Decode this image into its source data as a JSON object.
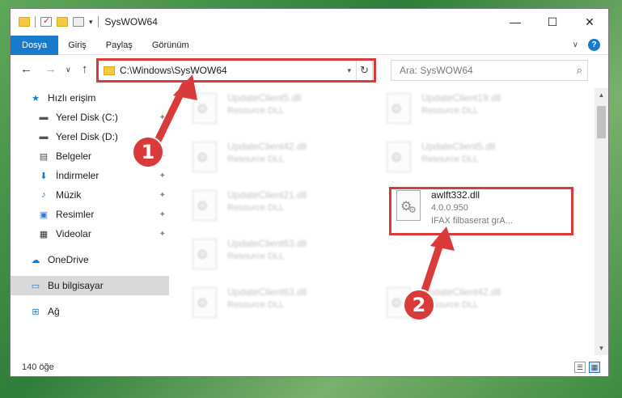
{
  "window": {
    "title": "SysWOW64",
    "controls": {
      "minimize": "—",
      "maximize": "☐",
      "close": "✕"
    }
  },
  "ribbon": {
    "tabs": [
      "Dosya",
      "Giriş",
      "Paylaş",
      "Görünüm"
    ],
    "expand": "∨",
    "help": "?"
  },
  "nav": {
    "back": "←",
    "forward": "→",
    "recent": "∨",
    "up": "↑",
    "address": "C:\\Windows\\SysWOW64",
    "refresh": "↻",
    "search_placeholder": "Ara: SysWOW64",
    "search_icon": "⌕"
  },
  "sidebar": {
    "items": [
      {
        "label": "Hızlı erişim",
        "icon": "star-icon",
        "glyph": "★",
        "color": "#1979ca",
        "pinned": false
      },
      {
        "label": "Yerel Disk (C:)",
        "icon": "drive-icon",
        "glyph": "▬",
        "color": "#555555",
        "pinned": true
      },
      {
        "label": "Yerel Disk (D:)",
        "icon": "drive-icon",
        "glyph": "▬",
        "color": "#555555",
        "pinned": true
      },
      {
        "label": "Belgeler",
        "icon": "document-icon",
        "glyph": "▤",
        "color": "#4a4a4a",
        "pinned": true
      },
      {
        "label": "İndirmeler",
        "icon": "download-icon",
        "glyph": "⬇",
        "color": "#1979ca",
        "pinned": true
      },
      {
        "label": "Müzik",
        "icon": "music-icon",
        "glyph": "♪",
        "color": "#1979ca",
        "pinned": true
      },
      {
        "label": "Resimler",
        "icon": "pictures-icon",
        "glyph": "▣",
        "color": "#3a7bd5",
        "pinned": true
      },
      {
        "label": "Videolar",
        "icon": "video-icon",
        "glyph": "▦",
        "color": "#333333",
        "pinned": true
      },
      {
        "label": "OneDrive",
        "icon": "cloud-icon",
        "glyph": "☁",
        "color": "#1979ca",
        "pinned": false
      },
      {
        "label": "Bu bilgisayar",
        "icon": "computer-icon",
        "glyph": "▭",
        "color": "#1979ca",
        "pinned": false
      },
      {
        "label": "Ağ",
        "icon": "network-icon",
        "glyph": "⊞",
        "color": "#1979ca",
        "pinned": false
      }
    ],
    "pin_glyph": "📌"
  },
  "files": {
    "left": [
      {
        "name": "UpdateClient5.dll",
        "sub": "Resource DLL"
      },
      {
        "name": "UpdateClient42.dll",
        "sub": "Resource DLL"
      },
      {
        "name": "UpdateClient21.dll",
        "sub": "Resource DLL"
      },
      {
        "name": "UpdateClient63.dll",
        "sub": "Resource DLL"
      },
      {
        "name": "UpdateClient63.dll",
        "sub": "Resource DLL"
      }
    ],
    "right": [
      {
        "name": "UpdateClient19.dll",
        "sub": "Resource DLL"
      },
      {
        "name": "UpdateClient5.dll",
        "sub": "Resource DLL"
      },
      {
        "name": "UpdateClient42.dll",
        "sub": "Resource DLL"
      }
    ],
    "highlighted": {
      "name": "awlft332.dll",
      "version": "4.0.0.950",
      "description": "IFAX filbaserat grA..."
    }
  },
  "status": {
    "count": "140 öğe"
  },
  "callouts": {
    "one": "1",
    "two": "2"
  },
  "colors": {
    "accent": "#1979ca",
    "highlight": "#d93a3a"
  }
}
